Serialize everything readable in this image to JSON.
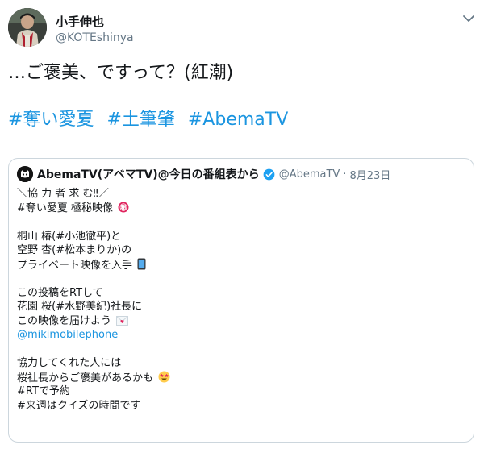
{
  "tweet": {
    "display_name": "小手伸也",
    "handle": "@KOTEshinya",
    "text": "…ご褒美、ですって？(紅潮)",
    "hashtags": [
      "#奪い愛夏",
      "#土筆肇",
      "#AbemaTV"
    ]
  },
  "quote": {
    "display_name": "AbemaTV(アベマTV)@今日の番組表から",
    "handle": "@AbemaTV",
    "separator": "·",
    "date": "8月23日",
    "lines": {
      "l1": "＼協 力 者 求 む‼／",
      "l2": "#奪い愛夏 極秘映像",
      "l3": "桐山 椿(#小池徹平)と",
      "l4": "空野 杏(#松本まりか)の",
      "l5": "プライベート映像を入手",
      "l6": "この投稿をRTして",
      "l7": "花園 桜(#水野美紀)社長に",
      "l8": "この映像を届けよう",
      "l9": "@mikimobilephone",
      "l10": "協力してくれた人には",
      "l11": "桜社長からご褒美があるかも",
      "l12": "#RTで予約",
      "l13": "#来週はクイズの時間です"
    },
    "emoji": {
      "secret": "㊙",
      "phone": "phone-icon",
      "love_letter": "love-letter-icon",
      "star_eyes": "star-struck-face-icon"
    }
  },
  "icons": {
    "menu": "chevron-down-icon",
    "verified": "verified-badge-icon"
  },
  "colors": {
    "link": "#1b95e0",
    "text": "#14171a",
    "secondary": "#657786",
    "border": "#ccd6dd",
    "verified": "#1da1f2",
    "secret": "#e0245e"
  }
}
